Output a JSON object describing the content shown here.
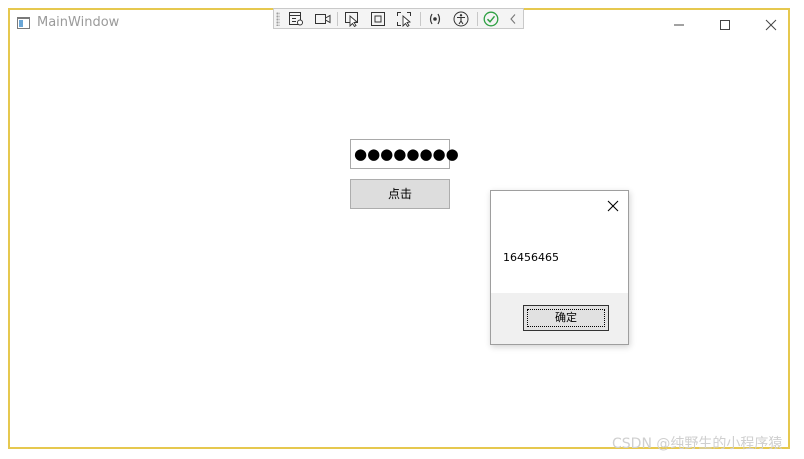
{
  "window": {
    "title": "MainWindow"
  },
  "toolbar": {
    "items": [
      "live-visual-tree-icon",
      "record-icon",
      "select-element-icon",
      "display-layout-adorners-icon",
      "track-focus-icon",
      "binding-failures-icon",
      "accessibility-icon",
      "check-icon",
      "collapse-chevron-icon"
    ]
  },
  "form": {
    "password_masked": "●●●●●●●●",
    "button_label": "点击"
  },
  "message_box": {
    "message": "16456465",
    "ok_label": "确定"
  },
  "watermark": "CSDN @纯野生的小程序猿",
  "colors": {
    "window_border": "#e6c84f",
    "button_bg": "#dddddd",
    "dialog_footer": "#f0f0f0",
    "check_green": "#2ea043"
  }
}
